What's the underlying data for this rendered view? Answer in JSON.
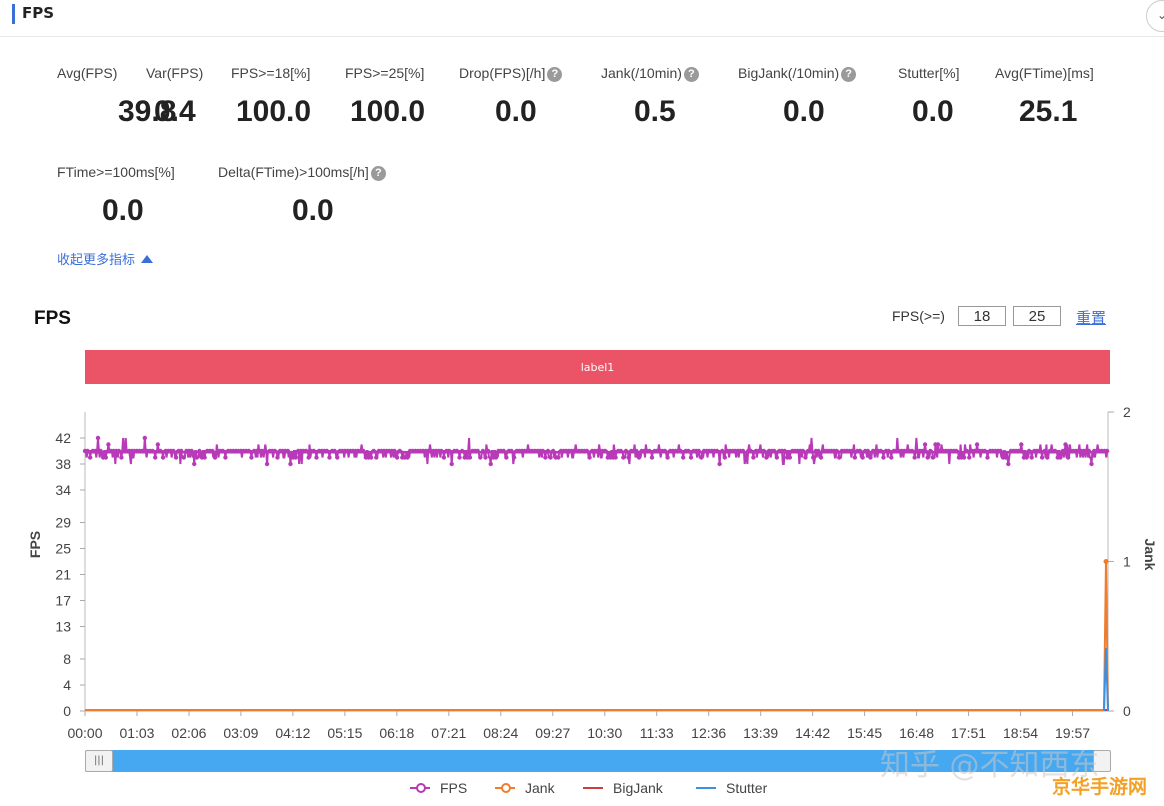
{
  "header": {
    "title": "FPS",
    "collapse_icon": "chevron-down-icon"
  },
  "metrics_row1": [
    {
      "label": "Avg(FPS)",
      "value": "39.8",
      "help": false
    },
    {
      "label": "Var(FPS)",
      "value": "0.4",
      "help": false
    },
    {
      "label": "FPS>=18[%]",
      "value": "100.0",
      "help": false
    },
    {
      "label": "FPS>=25[%]",
      "value": "100.0",
      "help": false
    },
    {
      "label": "Drop(FPS)[/h]",
      "value": "0.0",
      "help": true
    },
    {
      "label": "Jank(/10min)",
      "value": "0.5",
      "help": true
    },
    {
      "label": "BigJank(/10min)",
      "value": "0.0",
      "help": true
    },
    {
      "label": "Stutter[%]",
      "value": "0.0",
      "help": false
    },
    {
      "label": "Avg(FTime)[ms]",
      "value": "25.1",
      "help": false
    }
  ],
  "metrics_row2": [
    {
      "label": "FTime>=100ms[%]",
      "value": "0.0",
      "help": false
    },
    {
      "label": "Delta(FTime)>100ms[/h]",
      "value": "0.0",
      "help": true
    }
  ],
  "help_glyph": "?",
  "toggle_more": "收起更多指标",
  "chart_section": {
    "title": "FPS",
    "threshold_label": "FPS(>=)",
    "threshold_low": "18",
    "threshold_high": "25",
    "reset_label": "重置",
    "label_bar": "label1",
    "label_bar_color": "#ea5466"
  },
  "chart_data": {
    "type": "line",
    "ylabel": "FPS",
    "y2label": "Jank",
    "yticks": [
      "0",
      "4",
      "8",
      "13",
      "17",
      "21",
      "25",
      "29",
      "34",
      "38",
      "42"
    ],
    "ytick_values": [
      0,
      4,
      8,
      13,
      17,
      21,
      25,
      29,
      34,
      38,
      42
    ],
    "y2ticks": [
      "0",
      "1",
      "2"
    ],
    "y2ticks_values": [
      0,
      1,
      2
    ],
    "xticks": [
      "00:00",
      "01:03",
      "02:06",
      "03:09",
      "04:12",
      "05:15",
      "06:18",
      "07:21",
      "08:24",
      "09:27",
      "10:30",
      "11:33",
      "12:36",
      "13:39",
      "14:42",
      "15:45",
      "16:48",
      "17:51",
      "18:54",
      "19:57"
    ],
    "xrange_seconds": [
      0,
      1240
    ],
    "ylim": [
      0,
      46
    ],
    "y2lim": [
      0,
      2
    ],
    "series": [
      {
        "name": "FPS",
        "color": "#b83ab8",
        "approx_mean": 39.8,
        "approx_range": [
          37,
          42
        ]
      },
      {
        "name": "Jank",
        "color": "#ee7d30",
        "values_note": "0 throughout, spike to 1 at end",
        "end_spike": 1
      },
      {
        "name": "BigJank",
        "color": "#d03b3b",
        "values_note": "0 throughout"
      },
      {
        "name": "Stutter",
        "color": "#3d8fe0",
        "end_spike": 0.42
      }
    ],
    "legend_position": "bottom"
  },
  "slider": {
    "handle_glyph": "|||"
  },
  "watermark": "知乎 @不知西东",
  "corner_logo": "京华手游网"
}
